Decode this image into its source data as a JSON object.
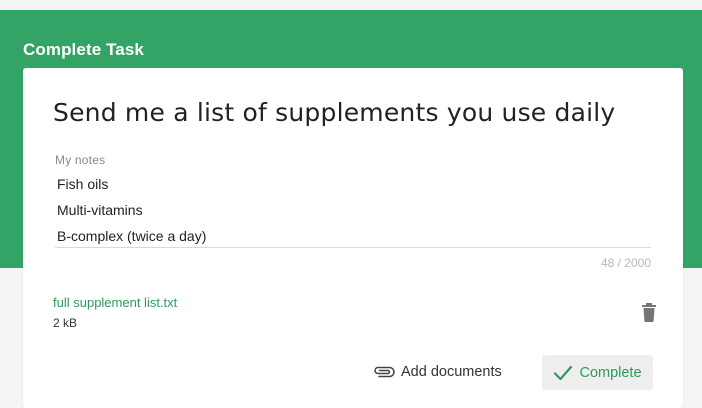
{
  "header": {
    "title": "Complete Task",
    "background": "#34a466"
  },
  "task": {
    "title": "Send me a list of supplements you use daily"
  },
  "notes": {
    "label": "My notes",
    "lines": [
      "Fish oils",
      "Multi-vitamins",
      "B-complex (twice a day)"
    ],
    "counter": "48 / 2000"
  },
  "attachment": {
    "name": "full supplement list.txt",
    "size": "2 kB",
    "delete_icon": "trash-icon"
  },
  "actions": {
    "add_documents_label": "Add documents",
    "add_documents_icon": "paperclip-icon",
    "complete_label": "Complete",
    "complete_icon": "checkmark-icon",
    "accent": "#2e9b5c"
  }
}
